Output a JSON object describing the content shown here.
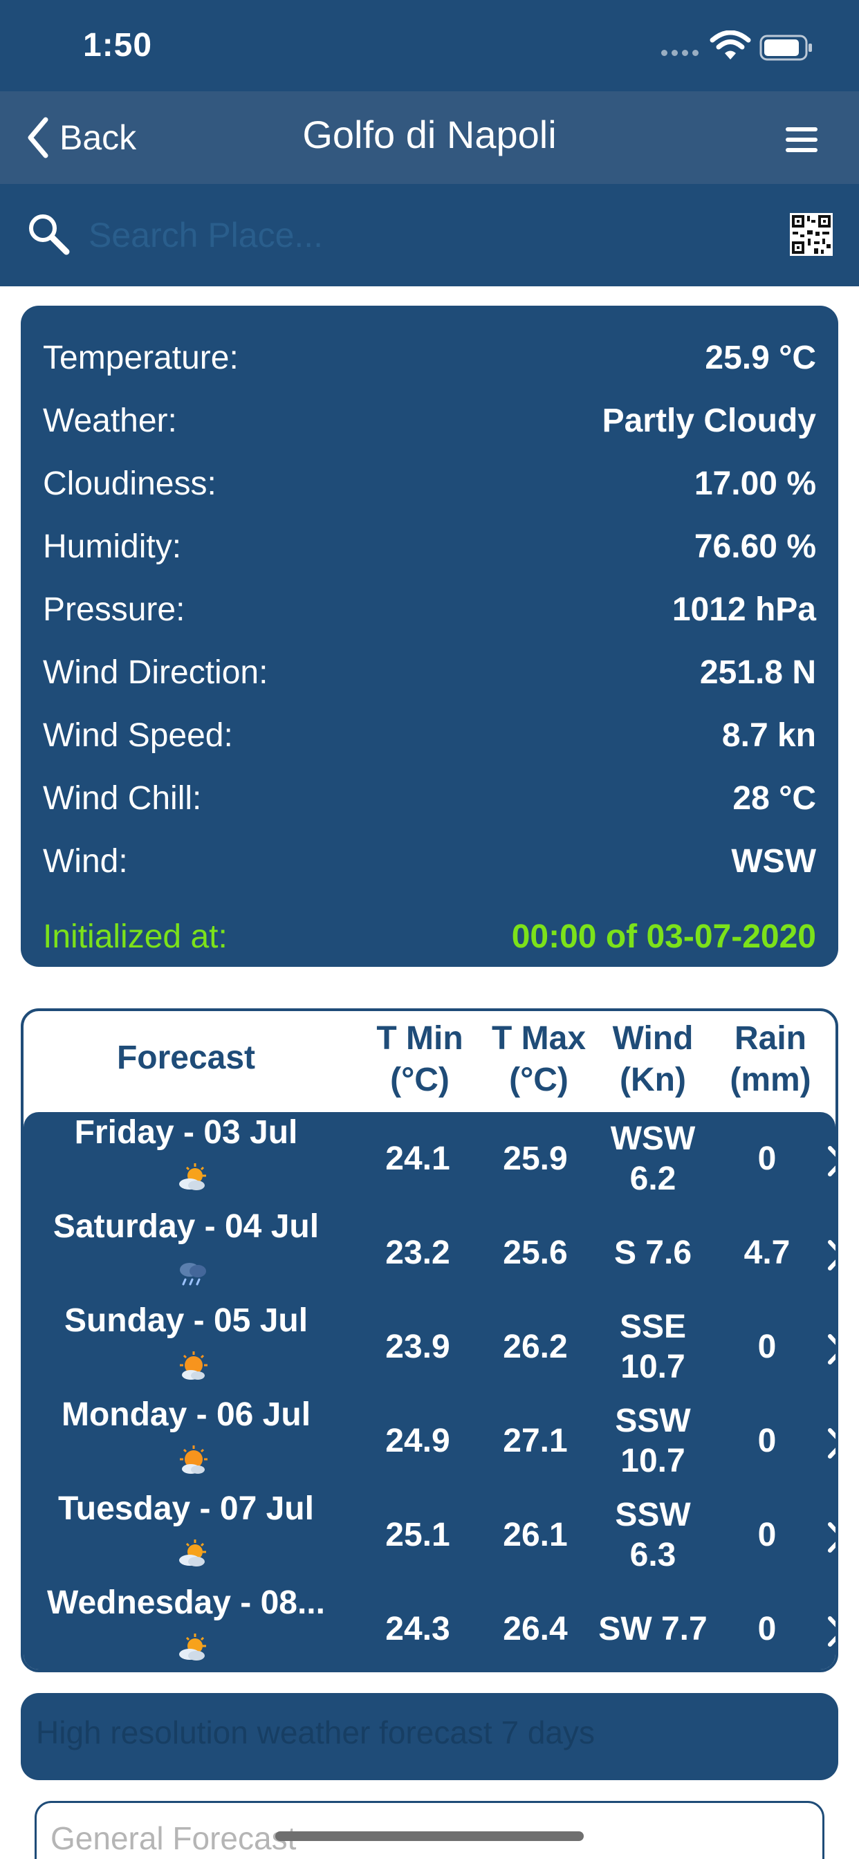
{
  "status_bar": {
    "time": "1:50"
  },
  "nav": {
    "back_label": "Back",
    "title": "Golfo di Napoli"
  },
  "search": {
    "placeholder": "Search Place..."
  },
  "current": {
    "rows": [
      {
        "label": "Temperature:",
        "value": "25.9 °C"
      },
      {
        "label": "Weather:",
        "value": "Partly Cloudy"
      },
      {
        "label": "Cloudiness:",
        "value": "17.00 %"
      },
      {
        "label": "Humidity:",
        "value": "76.60 %"
      },
      {
        "label": "Pressure:",
        "value": "1012 hPa"
      },
      {
        "label": "Wind Direction:",
        "value": "251.8 N"
      },
      {
        "label": "Wind Speed:",
        "value": "8.7 kn"
      },
      {
        "label": "Wind Chill:",
        "value": "28 °C"
      },
      {
        "label": "Wind:",
        "value": "WSW"
      }
    ],
    "initialized_label": "Initialized at:",
    "initialized_value": "00:00 of 03-07-2020",
    "initialized_color": "#7ce21a"
  },
  "forecast": {
    "headers": {
      "day": "Forecast",
      "tmin": "T Min\n(°C)",
      "tmax": "T Max\n(°C)",
      "wind": "Wind\n(Kn)",
      "rain": "Rain\n(mm)"
    },
    "rows": [
      {
        "day": "Friday - 03 Jul",
        "icon": "partly-cloudy-icon",
        "tmin": "24.1",
        "tmax": "25.9",
        "wind": "WSW\n6.2",
        "rain": "0"
      },
      {
        "day": "Saturday - 04 Jul",
        "icon": "rain-cloud-icon",
        "tmin": "23.2",
        "tmax": "25.6",
        "wind": "S 7.6",
        "rain": "4.7"
      },
      {
        "day": "Sunday - 05 Jul",
        "icon": "sun-cloud-icon",
        "tmin": "23.9",
        "tmax": "26.2",
        "wind": "SSE\n10.7",
        "rain": "0"
      },
      {
        "day": "Monday - 06 Jul",
        "icon": "sun-cloud-icon",
        "tmin": "24.9",
        "tmax": "27.1",
        "wind": "SSW\n10.7",
        "rain": "0"
      },
      {
        "day": "Tuesday - 07 Jul",
        "icon": "partly-cloudy-icon",
        "tmin": "25.1",
        "tmax": "26.1",
        "wind": "SSW\n6.3",
        "rain": "0"
      },
      {
        "day": "Wednesday - 08...",
        "icon": "partly-cloudy-icon",
        "tmin": "24.3",
        "tmax": "26.4",
        "wind": "SW 7.7",
        "rain": "0"
      }
    ]
  },
  "hires": {
    "label": "High resolution weather forecast 7 days"
  },
  "general": {
    "label": "General Forecast"
  },
  "colors": {
    "primary": "#1f4c78",
    "nav": "#33587f",
    "accent_green": "#7ce21a"
  }
}
